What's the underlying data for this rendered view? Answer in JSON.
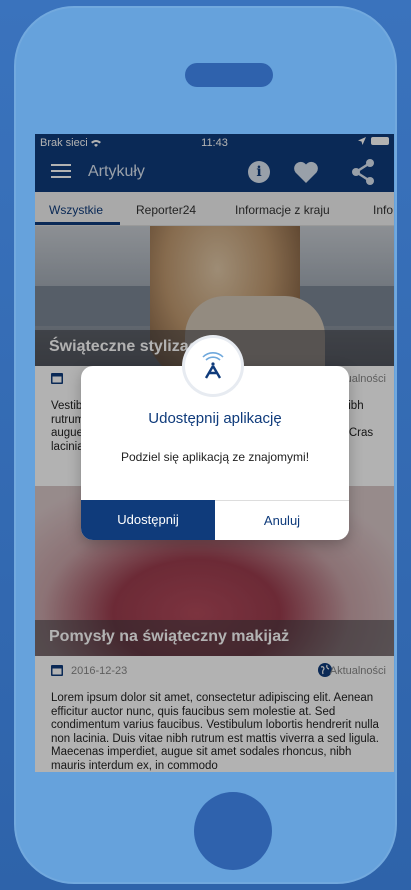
{
  "status": {
    "carrier": "Brak sieci",
    "time": "11:43"
  },
  "appbar": {
    "title": "Artykuły",
    "info_glyph": "i"
  },
  "tabs": [
    "Wszystkie",
    "Reporter24",
    "Informacje z kraju",
    "Info"
  ],
  "articles": [
    {
      "title": "Świąteczne stylizacje",
      "category": "Aktualności",
      "excerpt": "Vestibulum lobortis hendrerit nulla non lacinia. Duis vitae nibh rutrum est mattis viverra a sed ligula. Maecenas imperdiet, augue sit amet sodales rhoncus, nibh mauris interdum ex. Cras lacinia..."
    },
    {
      "title": "Pomysły na świąteczny makijaż",
      "date": "2016-12-23",
      "category": "Aktualności",
      "excerpt": "Lorem ipsum dolor sit amet, consectetur adipiscing elit. Aenean efficitur auctor nunc, quis faucibus sem molestie at. Sed condimentum varius faucibus. Vestibulum lobortis hendrerit nulla non lacinia. Duis vitae nibh rutrum est mattis viverra a sed ligula. Maecenas imperdiet, augue sit amet sodales rhoncus, nibh mauris interdum ex, in commodo"
    }
  ],
  "dialog": {
    "title": "Udostępnij aplikację",
    "message": "Podziel się aplikacją ze znajomymi!",
    "share_label": "Udostępnij",
    "cancel_label": "Anuluj"
  },
  "icons": [
    "wifi-icon",
    "location-arrow-icon",
    "battery-icon",
    "menu-icon",
    "info-icon",
    "heart-icon",
    "share-icon",
    "calendar-icon",
    "globe-icon",
    "app-logo-icon"
  ],
  "colors": {
    "brand": "#0f3b7b",
    "phone_body": "#66a2dc",
    "background": "#3a73bd"
  }
}
